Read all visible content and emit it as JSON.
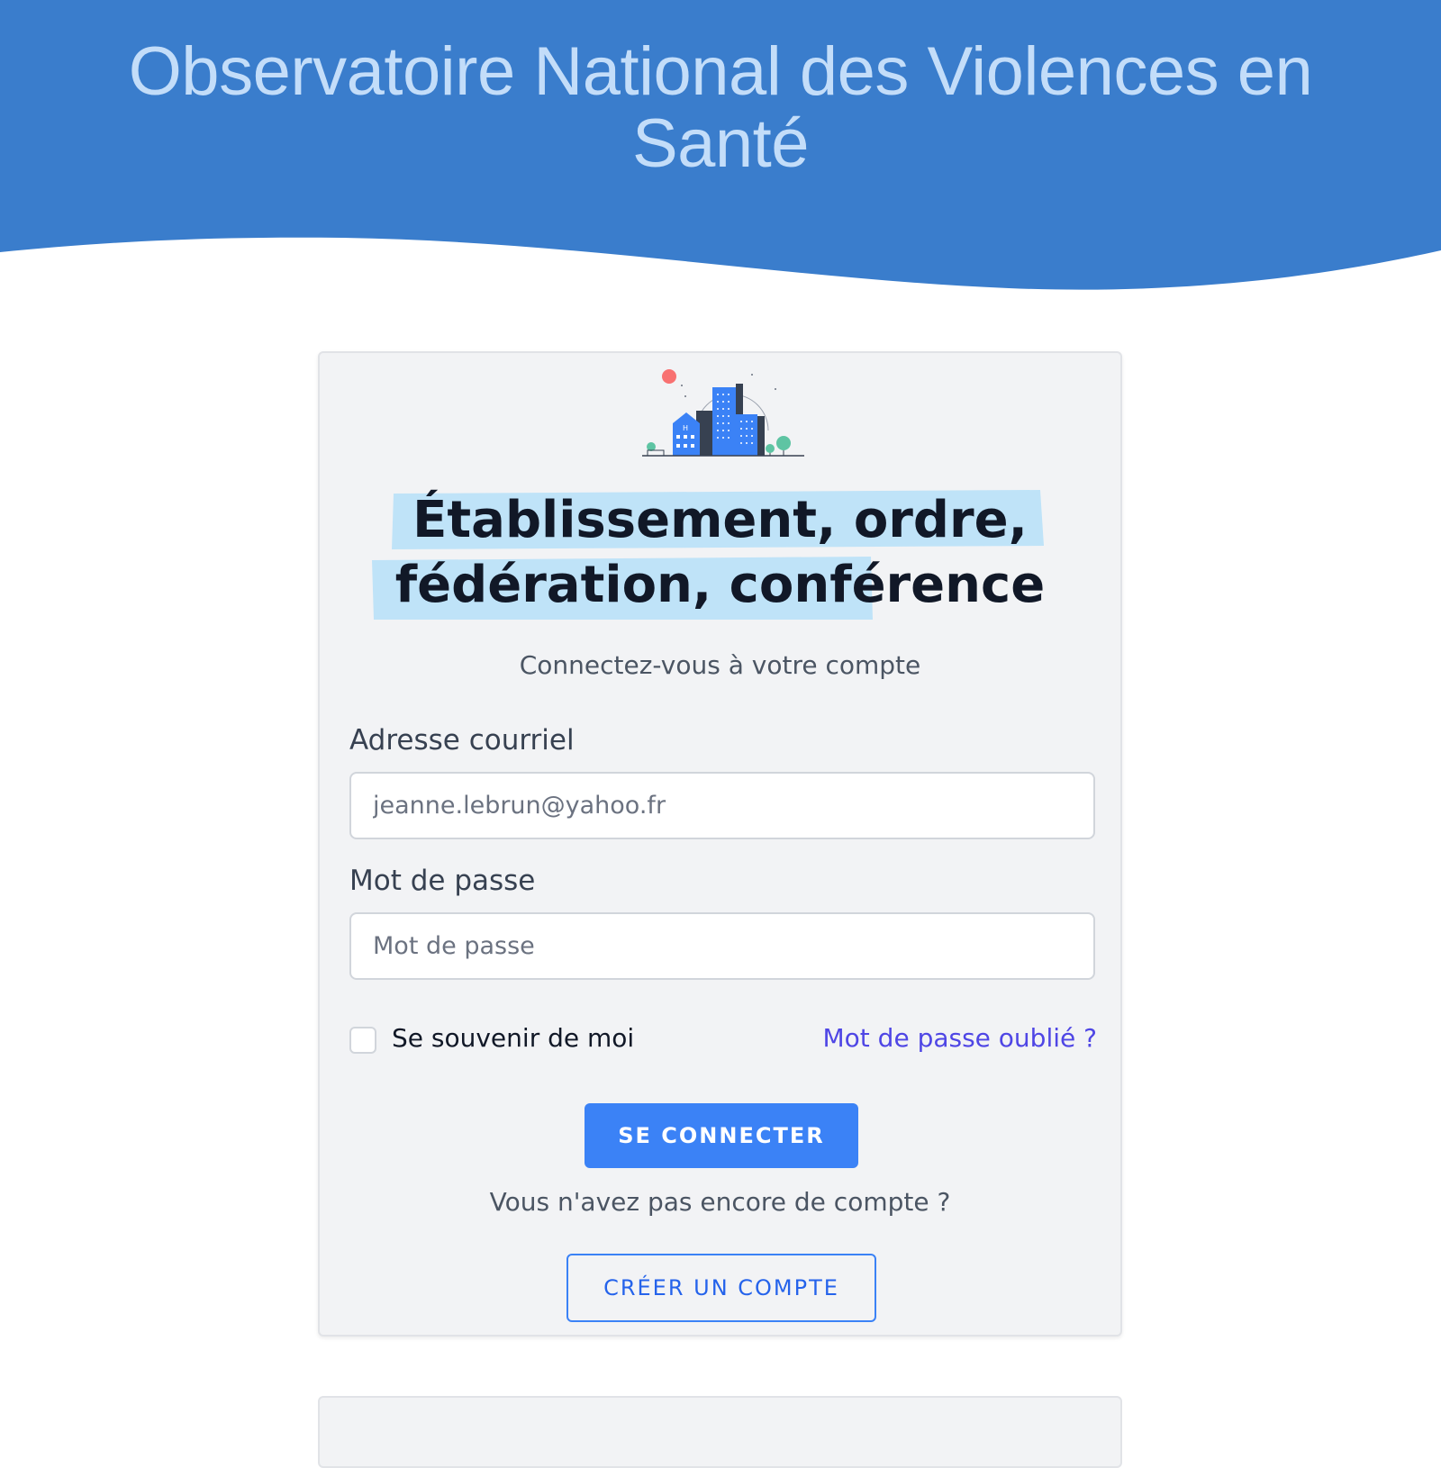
{
  "header": {
    "title": "Observatoire National des Violences en Santé"
  },
  "login_card": {
    "heading": "Établissement, ordre, fédération, conférence",
    "subtitle": "Connectez-vous à votre compte",
    "email": {
      "label": "Adresse courriel",
      "placeholder": "jeanne.lebrun@yahoo.fr"
    },
    "password": {
      "label": "Mot de passe",
      "placeholder": "Mot de passe"
    },
    "remember_me": "Se souvenir de moi",
    "forgot_password": "Mot de passe oublié ?",
    "submit_label": "SE CONNECTER",
    "no_account_text": "Vous n'avez pas encore de compte ?",
    "create_account_label": "CRÉER UN COMPTE"
  },
  "colors": {
    "header_bg": "#3a7dcc",
    "header_text": "#c3ddf9",
    "primary": "#3b82f6",
    "link": "#4f46e5",
    "highlight": "#bfe3f8"
  },
  "icons": {
    "illustration": "hospital-buildings-illustration"
  }
}
